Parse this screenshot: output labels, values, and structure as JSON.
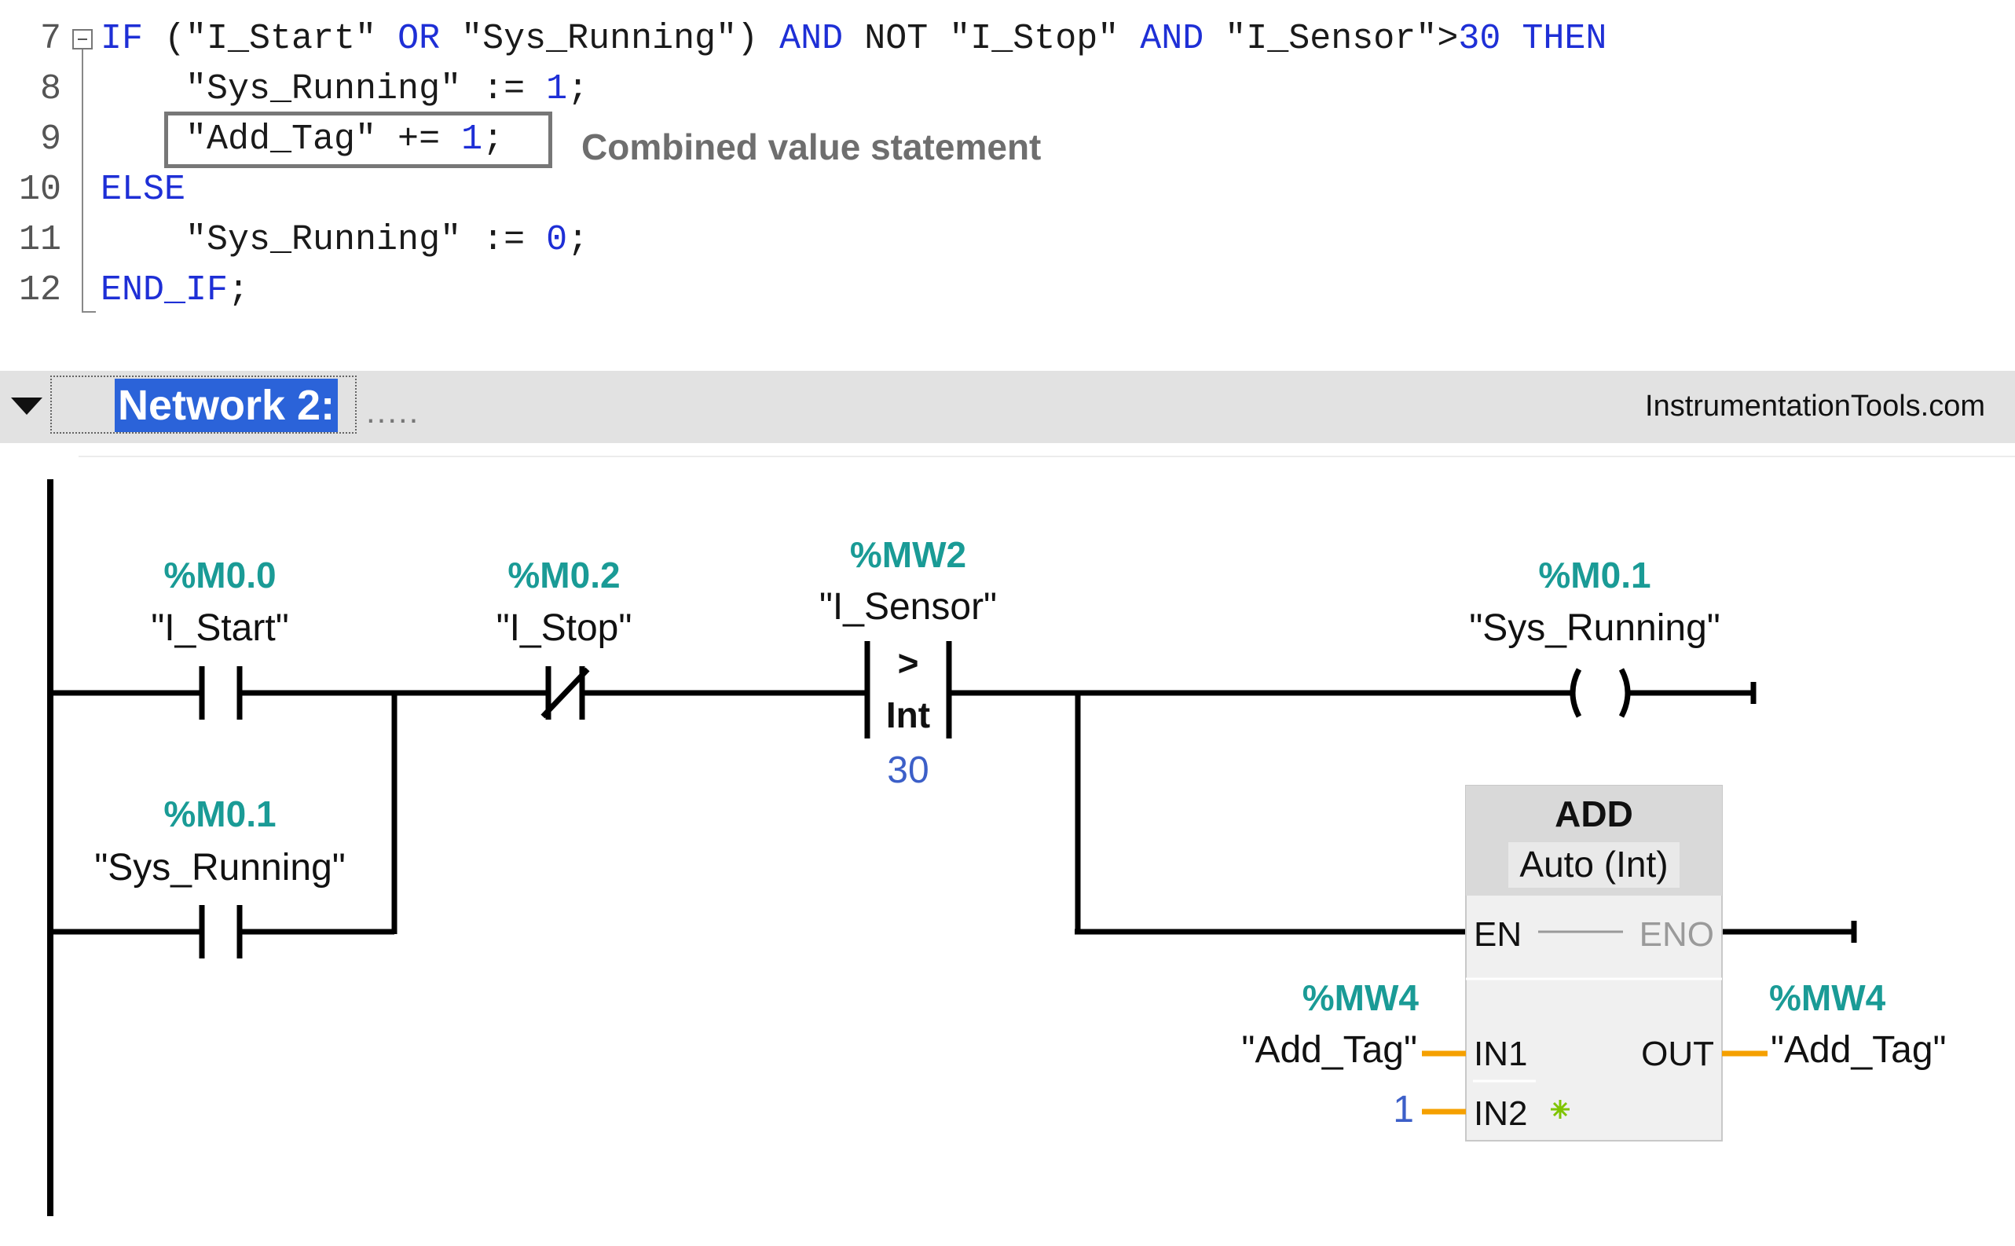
{
  "code": {
    "lines": [
      {
        "no": "7"
      },
      {
        "no": "8"
      },
      {
        "no": "9"
      },
      {
        "no": "10"
      },
      {
        "no": "11"
      },
      {
        "no": "12"
      }
    ],
    "line7": {
      "kw_if": "IF",
      "p1": " (\"I_Start\" ",
      "kw_or": "OR",
      "p2": " \"Sys_Running\") ",
      "kw_and1": "AND",
      "p3": " NOT \"I_Stop\" ",
      "kw_and2": "AND",
      "p4": " \"I_Sensor\">",
      "num": "30",
      "kw_then": "THEN"
    },
    "line8": {
      "p1": "    \"Sys_Running\" := ",
      "num": "1",
      "p2": ";"
    },
    "line9": {
      "p1": "    \"Add_Tag\" += ",
      "num": "1",
      "p2": ";"
    },
    "line10": {
      "kw": "ELSE"
    },
    "line11": {
      "p1": "    \"Sys_Running\" := ",
      "num": "0",
      "p2": ";"
    },
    "line12": {
      "kw": "END_IF",
      "p1": ";"
    },
    "annotation": "Combined value statement"
  },
  "network": {
    "title": "Network 2:",
    "dots": ".....",
    "watermark": "InstrumentationTools.com"
  },
  "ladder": {
    "contact_start": {
      "address": "%M0.0",
      "tag": "\"I_Start\""
    },
    "contact_running": {
      "address": "%M0.1",
      "tag": "\"Sys_Running\""
    },
    "contact_stop": {
      "address": "%M0.2",
      "tag": "\"I_Stop\""
    },
    "compare": {
      "address": "%MW2",
      "tag": "\"I_Sensor\"",
      "op": ">",
      "type": "Int",
      "value": "30"
    },
    "coil": {
      "address": "%M0.1",
      "tag": "\"Sys_Running\""
    },
    "add_block": {
      "name": "ADD",
      "type": "Auto (Int)",
      "en": "EN",
      "eno": "ENO",
      "in1": "IN1",
      "in2": "IN2",
      "out": "OUT",
      "in1_address": "%MW4",
      "in1_tag": "\"Add_Tag\"",
      "in2_value": "1",
      "out_address": "%MW4",
      "out_tag": "\"Add_Tag\""
    }
  },
  "colors": {
    "keyword": "#1e2fd6",
    "address": "#1a9b96",
    "wire": "#000000",
    "param_wire": "#f5a000",
    "selection": "#2b63d9"
  }
}
